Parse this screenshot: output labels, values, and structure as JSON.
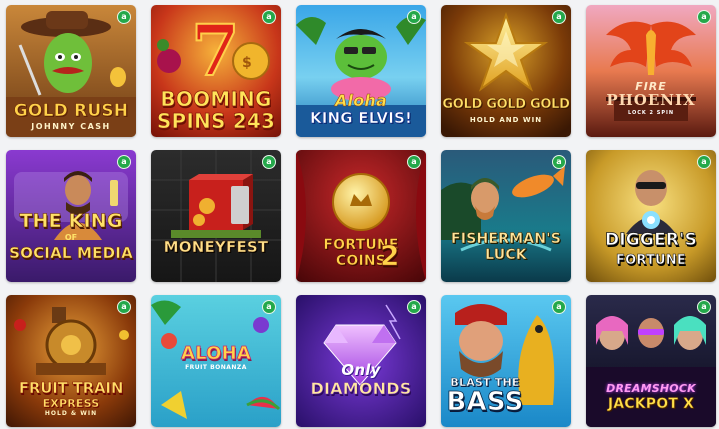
{
  "badge_symbol": "a",
  "colors": {
    "background": "#f2f3f5",
    "badge": "#24a84a"
  },
  "games": [
    {
      "title_line1": "GOLD RUSH",
      "title_line2": "JOHNNY CASH"
    },
    {
      "title_line1": "BOOMING",
      "title_line2": "SPINS 243"
    },
    {
      "title_line1": "Aloha",
      "title_line2": "KING ELVIS!"
    },
    {
      "title_line1": "GOLD GOLD GOLD",
      "title_line2": "HOLD AND WIN"
    },
    {
      "title_line1": "FIRE",
      "title_line2": "PHOENIX",
      "title_line3": "LOCK 2 SPIN"
    },
    {
      "title_line1": "THE KING",
      "title_line2": "OF",
      "title_line3": "SOCIAL MEDIA"
    },
    {
      "title_line1": "MONEYFEST"
    },
    {
      "title_line1": "FORTUNE",
      "title_line2": "COINS",
      "title_line3": "2"
    },
    {
      "title_line1": "FISHERMAN'S",
      "title_line2": "LUCK"
    },
    {
      "title_line1": "DIGGER'S",
      "title_line2": "FORTUNE"
    },
    {
      "title_line1": "FRUIT TRAIN",
      "title_line2": "EXPRESS",
      "title_line3": "HOLD & WIN"
    },
    {
      "title_line1": "ALOHA",
      "title_line2": "FRUIT BONANZA"
    },
    {
      "title_line1": "Only",
      "title_line2": "DIAMONDS"
    },
    {
      "title_line1": "BLAST THE",
      "title_line2": "BASS"
    },
    {
      "title_line1": "DREAMSHOCK",
      "title_line2": "JACKPOT X"
    }
  ]
}
